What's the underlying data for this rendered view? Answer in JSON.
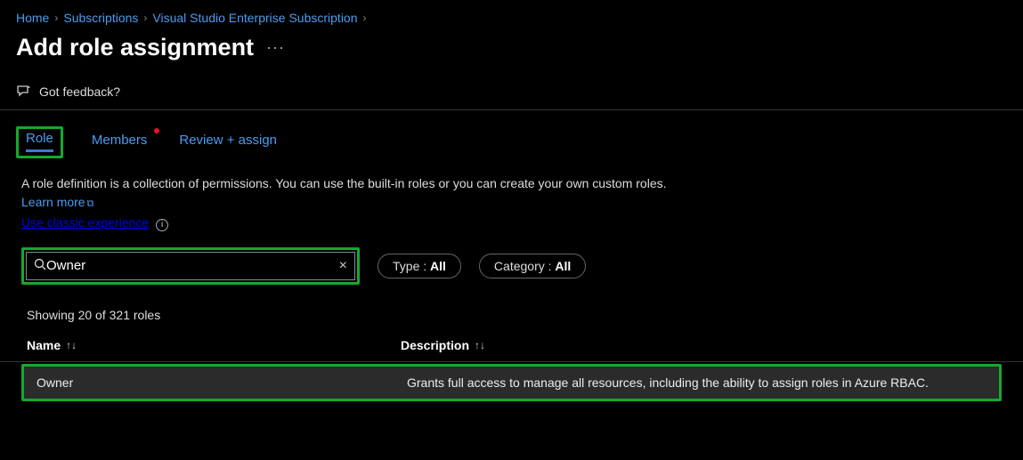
{
  "breadcrumb": {
    "items": [
      "Home",
      "Subscriptions",
      "Visual Studio Enterprise Subscription"
    ]
  },
  "page": {
    "title": "Add role assignment"
  },
  "feedback": {
    "label": "Got feedback?"
  },
  "tabs": {
    "role": "Role",
    "members": "Members",
    "review": "Review + assign"
  },
  "description": {
    "text1": "A role definition is a collection of permissions. You can use the built-in roles or you can create your own custom roles. ",
    "learn_more": "Learn more",
    "classic": "Use classic experience"
  },
  "filters": {
    "search_value": "Owner",
    "type_label": "Type : ",
    "type_value": "All",
    "category_label": "Category : ",
    "category_value": "All"
  },
  "results": {
    "count_text": "Showing 20 of 321 roles",
    "headers": {
      "name": "Name",
      "description": "Description"
    },
    "rows": [
      {
        "name": "Owner",
        "description": "Grants full access to manage all resources, including the ability to assign roles in Azure RBAC."
      }
    ]
  }
}
